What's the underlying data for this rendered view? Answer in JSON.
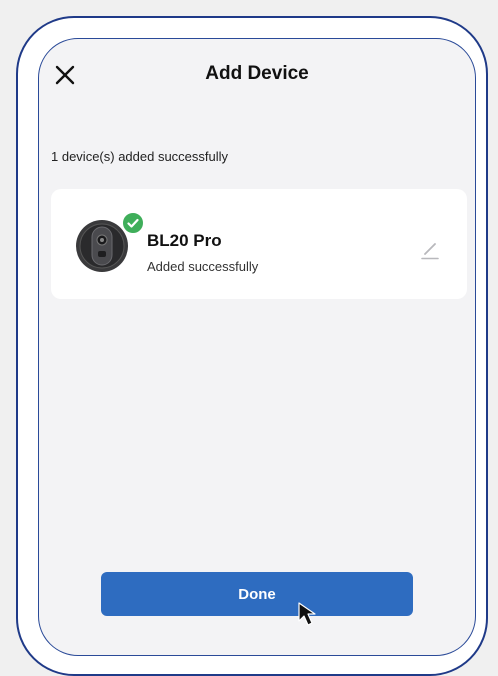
{
  "header": {
    "title": "Add Device",
    "close_icon": "close-icon"
  },
  "summary": {
    "text": "1 device(s) added successfully"
  },
  "device": {
    "name": "BL20 Pro",
    "status": "Added successfully",
    "status_icon": "check-icon",
    "edit_icon": "pencil-icon"
  },
  "actions": {
    "done_label": "Done"
  },
  "colors": {
    "primary": "#2e6cc0",
    "success": "#3fae5a",
    "background": "#f3f3f5",
    "card": "#ffffff"
  }
}
